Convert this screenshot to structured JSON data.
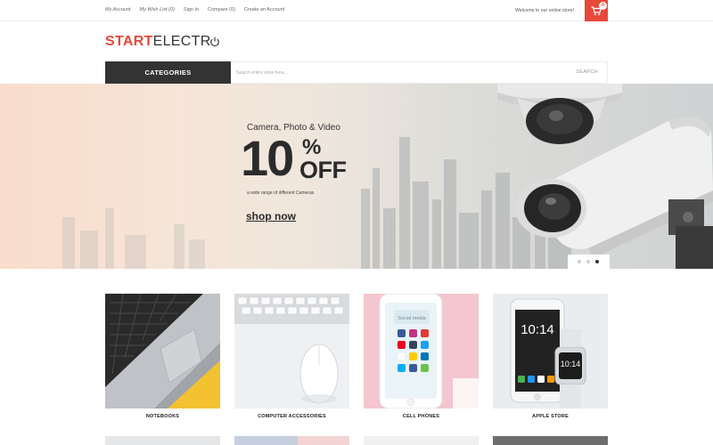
{
  "topbar": {
    "links": [
      "My Account",
      "My Wish List (0)",
      "Sign In",
      "Compare (0)",
      "Create an Account"
    ],
    "welcome": "Welcome to our online store!",
    "cart_count": "0",
    "cart_icon": "cart-icon"
  },
  "logo": {
    "part1": "START",
    "part2": "ELECTR",
    "icon": "power-icon"
  },
  "nav": {
    "categories_label": "CATEGORIES",
    "search_placeholder": "Search entire store here...",
    "search_button": "SEARCH"
  },
  "hero": {
    "subtitle": "Camera, Photo & Video",
    "discount_number": "10",
    "discount_percent": "%",
    "discount_off": "OFF",
    "description": "a wide range of different Cameras",
    "cta": "shop now",
    "slides": 3,
    "active_slide": 3
  },
  "categories": [
    {
      "label": "NOTEBOOKS",
      "image": "laptop-photo"
    },
    {
      "label": "COMPUTER ACCESSORIES",
      "image": "keyboard-mouse-photo"
    },
    {
      "label": "CELL PHONES",
      "image": "smartphone-photo"
    },
    {
      "label": "APPLE STORE",
      "image": "iphone-watch-photo"
    }
  ],
  "phone_screen": {
    "app_label": "Social media",
    "clock": "10:14"
  },
  "colors": {
    "accent": "#e8483a",
    "dark": "#333333",
    "hero_left": "#f9dccb",
    "hero_right": "#cfd2d3"
  }
}
